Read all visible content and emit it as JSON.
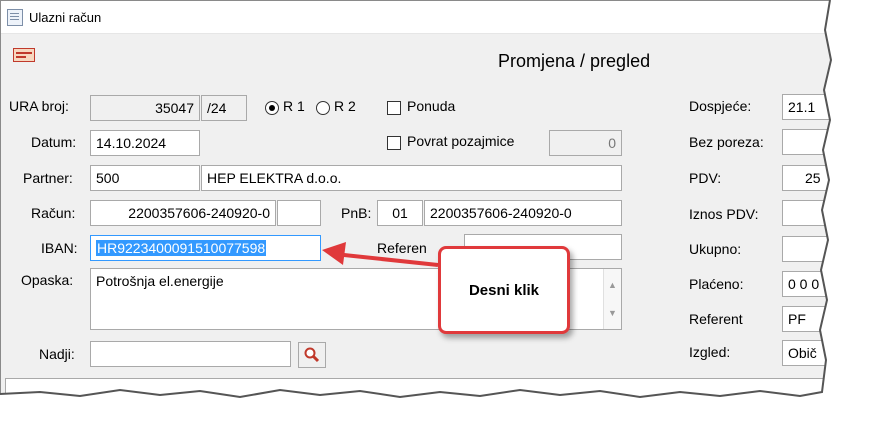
{
  "window": {
    "title": "Ulazni račun"
  },
  "header": {
    "mode_title": "Promjena / pregled"
  },
  "ura": {
    "label": "URA broj:",
    "number": "35047",
    "suffix": "/24",
    "r1_label": "R 1",
    "r2_label": "R 2",
    "selected": "R 1"
  },
  "ponuda": {
    "label": "Ponuda",
    "checked": false
  },
  "datum": {
    "label": "Datum:",
    "value": "14.10.2024"
  },
  "povrat": {
    "label": "Povrat pozajmice",
    "checked": false,
    "value": "0"
  },
  "partner": {
    "label": "Partner:",
    "code": "500",
    "name": "HEP ELEKTRA d.o.o."
  },
  "racun": {
    "label": "Račun:",
    "value": "2200357606-240920-0",
    "extra": ""
  },
  "pnb": {
    "label": "PnB:",
    "model": "01",
    "value": "2200357606-240920-0"
  },
  "iban": {
    "label": "IBAN:",
    "value": "HR9223400091510077598"
  },
  "referent_short": {
    "label": "Referen"
  },
  "opaska": {
    "label": "Opaska:",
    "value": "Potrošnja el.energije"
  },
  "nadji": {
    "label": "Nadji:",
    "value": ""
  },
  "right_panel": {
    "dospijece_label": "Dospjeće:",
    "dospijece_value": "21.1",
    "bez_poreza_label": "Bez poreza:",
    "pdv_label": "PDV:",
    "pdv_value": "25",
    "iznos_pdv_label": "Iznos PDV:",
    "ukupno_label": "Ukupno:",
    "placeno_label": "Plaćeno:",
    "placeno_value": "0 0 0",
    "referent_label": "Referent",
    "referent_value": "PF",
    "izgled_label": "Izgled:",
    "izgled_value": "Obič"
  },
  "callout": {
    "text": "Desni klik",
    "color": "#e0393b"
  }
}
